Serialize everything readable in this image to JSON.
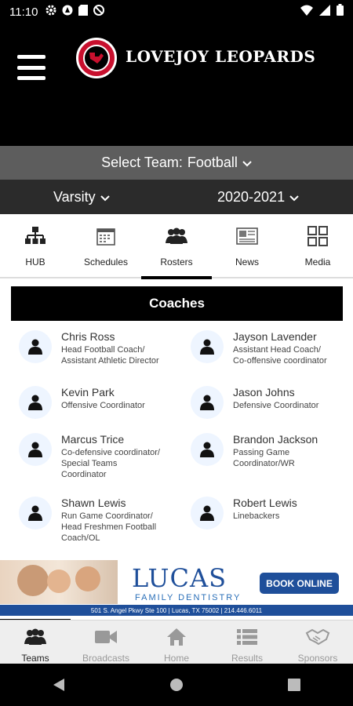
{
  "status_bar": {
    "time": "11:10",
    "left_icons": [
      "gear-icon",
      "arrow-notification-icon",
      "sd-card-icon",
      "no-sim-icon"
    ],
    "right_icons": [
      "wifi-icon",
      "signal-icon",
      "battery-icon"
    ]
  },
  "header": {
    "title": "LOVEJOY LEOPARDS",
    "logo_text": "LOVEJOY LEOPARDS",
    "brand_color": "#c8102e"
  },
  "team_selector": {
    "label": "Select Team:",
    "value": "Football"
  },
  "level_selector": {
    "value": "Varsity"
  },
  "season_selector": {
    "value": "2020-2021"
  },
  "tabs": [
    {
      "label": "HUB",
      "icon": "hierarchy-icon"
    },
    {
      "label": "Schedules",
      "icon": "calendar-icon"
    },
    {
      "label": "Rosters",
      "icon": "group-icon",
      "active": true
    },
    {
      "label": "News",
      "icon": "newspaper-icon"
    },
    {
      "label": "Media",
      "icon": "grid-icon"
    }
  ],
  "coaches_section": {
    "heading": "Coaches",
    "coaches": [
      {
        "name": "Chris Ross",
        "role": "Head Football Coach/\nAssistant Athletic Director"
      },
      {
        "name": "Jayson Lavender",
        "role": "Assistant Head Coach/\nCo-offensive coordinator"
      },
      {
        "name": "Kevin  Park",
        "role": "Offensive Coordinator"
      },
      {
        "name": "Jason Johns",
        "role": "Defensive Coordinator"
      },
      {
        "name": "Marcus  Trice",
        "role": "Co-defensive coordinator/\nSpecial Teams\nCoordinator"
      },
      {
        "name": "Brandon  Jackson",
        "role": "Passing Game\nCoordinator/WR"
      },
      {
        "name": "Shawn Lewis",
        "role": "Run Game Coordinator/\nHead Freshmen Football\nCoach/OL"
      },
      {
        "name": "Robert Lewis",
        "role": "Linebackers"
      }
    ]
  },
  "ad": {
    "brand": "LUCAS",
    "tagline": "FAMILY DENTISTRY",
    "cta": "BOOK ONLINE",
    "address": "501 S. Angel Pkwy Ste 100  |  Lucas, TX 75002  |  214.446.6011",
    "accent_color": "#1f4f9a"
  },
  "bottom_nav": [
    {
      "label": "Teams",
      "icon": "teams-icon",
      "active": true
    },
    {
      "label": "Broadcasts",
      "icon": "video-camera-icon"
    },
    {
      "label": "Home",
      "icon": "home-icon"
    },
    {
      "label": "Results",
      "icon": "list-icon"
    },
    {
      "label": "Sponsors",
      "icon": "handshake-icon"
    }
  ]
}
